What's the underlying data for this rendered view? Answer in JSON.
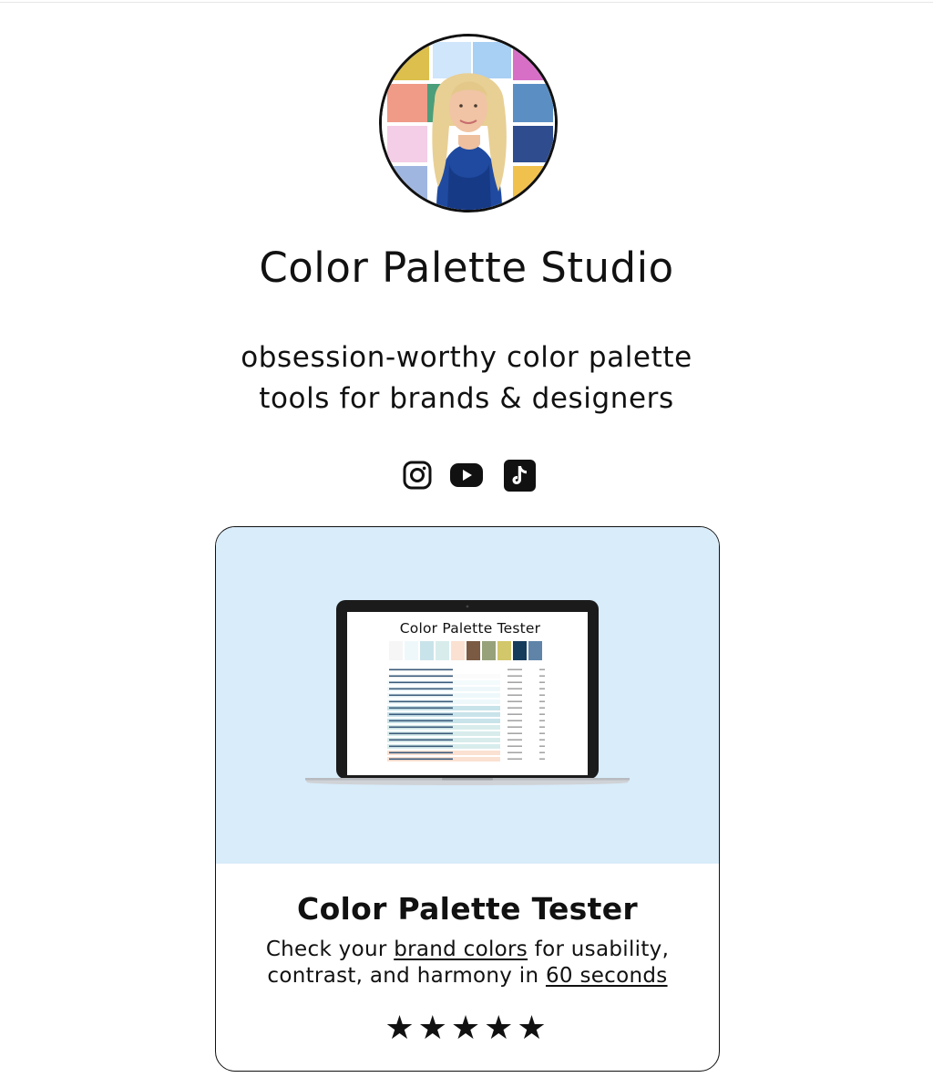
{
  "profile": {
    "name": "Color Palette Studio",
    "bio_line1": "obsession-worthy color palette",
    "bio_line2": "tools for brands & designers"
  },
  "socials": [
    {
      "icon": "instagram-icon"
    },
    {
      "icon": "youtube-icon"
    },
    {
      "icon": "tiktok-icon"
    }
  ],
  "card": {
    "screen_title": "Color Palette Tester",
    "title": "Color Palette Tester",
    "desc_part1": "Check your ",
    "desc_link1": "brand colors",
    "desc_part2": " for usability, contrast, and harmony in ",
    "desc_link2": "60 seconds",
    "rating_stars": "★★★★★",
    "rating_value": 5,
    "hero_bg": "#d8ecfa"
  },
  "colors": {
    "text": "#111111",
    "background": "#ffffff",
    "card_hero": "#d8ecfa"
  }
}
